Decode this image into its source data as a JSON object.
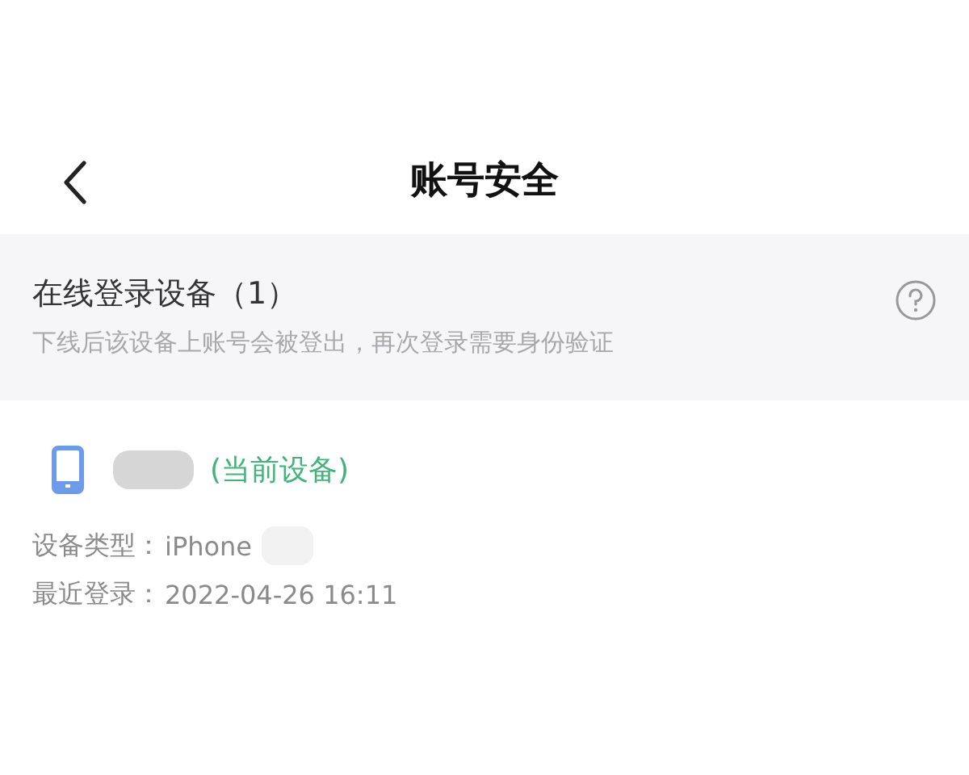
{
  "header": {
    "title": "账号安全"
  },
  "section": {
    "title": "在线登录设备（1）",
    "subtitle": "下线后该设备上账号会被登出，再次登录需要身份验证"
  },
  "devices": [
    {
      "current": true,
      "current_label": "(当前设备)",
      "type_label": "设备类型：",
      "type": "iPhone",
      "login_label": "最近登录：",
      "login_time": "2022-04-26 16:11"
    }
  ]
}
